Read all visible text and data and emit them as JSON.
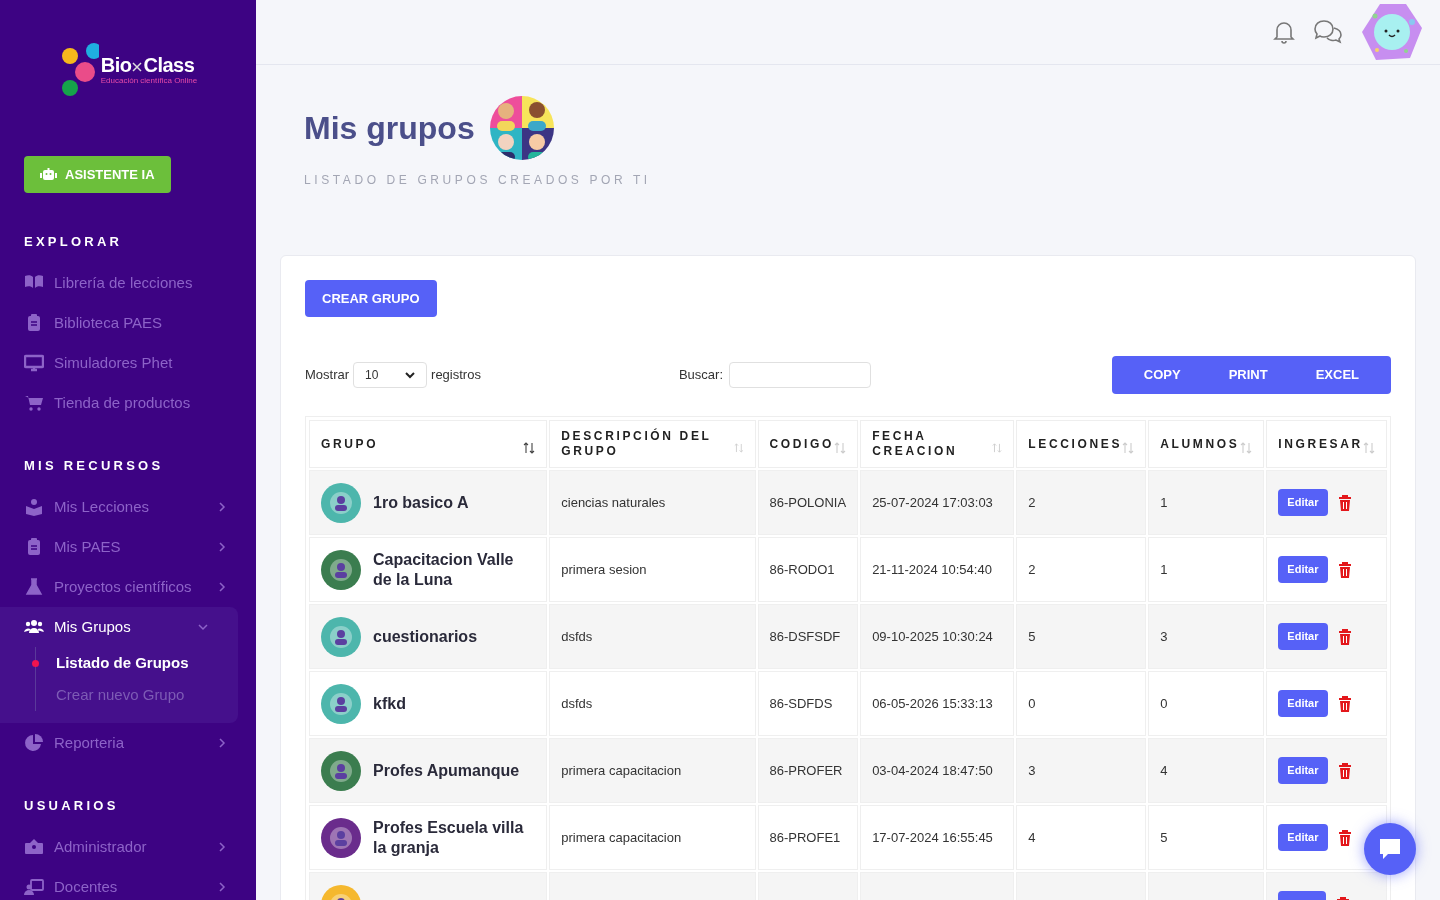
{
  "sidebar": {
    "logo": {
      "name": "Bio",
      "name2": "Class",
      "tagline": "Educación científica Online"
    },
    "assistant_button": "ASISTENTE IA",
    "sections": [
      {
        "title": "EXPLORAR",
        "items": [
          {
            "label": "Librería de lecciones",
            "kind": "book"
          },
          {
            "label": "Biblioteca PAES",
            "kind": "clipboard"
          },
          {
            "label": "Simuladores Phet",
            "kind": "monitor"
          },
          {
            "label": "Tienda de productos",
            "kind": "cart"
          }
        ]
      },
      {
        "title": "MIS RECURSOS",
        "items": [
          {
            "label": "Mis Lecciones",
            "kind": "reader",
            "expanded": false
          },
          {
            "label": "Mis PAES",
            "kind": "clipboard",
            "expanded": false
          },
          {
            "label": "Proyectos científicos",
            "kind": "flask",
            "expanded": false
          },
          {
            "label": "Mis Grupos",
            "kind": "users",
            "expanded": true,
            "children": [
              {
                "label": "Listado de Grupos",
                "selected": true
              },
              {
                "label": "Crear nuevo Grupo",
                "selected": false
              }
            ]
          },
          {
            "label": "Reporteria",
            "kind": "pie",
            "expanded": false
          }
        ]
      },
      {
        "title": "USUARIOS",
        "items": [
          {
            "label": "Administrador",
            "kind": "admin",
            "expanded": false
          },
          {
            "label": "Docentes",
            "kind": "teacher",
            "expanded": false
          }
        ]
      }
    ]
  },
  "header": {
    "title": "Mis grupos",
    "subtitle": "LISTADO DE GRUPOS CREADOS POR TI"
  },
  "create_button": "CREAR GRUPO",
  "length_control": {
    "before": "Mostrar",
    "value": "10",
    "after": "registros"
  },
  "search": {
    "label": "Buscar:"
  },
  "export_buttons": [
    "COPY",
    "PRINT",
    "EXCEL"
  ],
  "table": {
    "columns": [
      {
        "label": "GRUPO",
        "sorted": true
      },
      {
        "label": "DESCRIPCIÓN DEL GRUPO",
        "sorted": false
      },
      {
        "label": "CODIGO",
        "sorted": false
      },
      {
        "label": "FECHA CREACION",
        "sorted": false
      },
      {
        "label": "LECCIONES",
        "sorted": false
      },
      {
        "label": "ALUMNOS",
        "sorted": false
      },
      {
        "label": "INGRESAR",
        "sorted": false
      }
    ],
    "rows": [
      {
        "name": "1ro basico A",
        "color": "#4db6ac",
        "description": "ciencias naturales",
        "code": "86-POLONIA",
        "date": "25-07-2024 17:03:03",
        "lessons": "2",
        "students": "1",
        "action": "Editar"
      },
      {
        "name": "Capacitacion Valle de la Luna",
        "color": "#3b7d4f",
        "description": "primera sesion",
        "code": "86-RODO1",
        "date": "21-11-2024 10:54:40",
        "lessons": "2",
        "students": "1",
        "action": "Editar"
      },
      {
        "name": "cuestionarios",
        "color": "#4db6ac",
        "description": "dsfds",
        "code": "86-DSFSDF",
        "date": "09-10-2025 10:30:24",
        "lessons": "5",
        "students": "3",
        "action": "Editar"
      },
      {
        "name": "kfkd",
        "color": "#4db6ac",
        "description": "dsfds",
        "code": "86-SDFDS",
        "date": "06-05-2026 15:33:13",
        "lessons": "0",
        "students": "0",
        "action": "Editar"
      },
      {
        "name": "Profes Apumanque",
        "color": "#3b7d4f",
        "description": "primera capacitacion",
        "code": "86-PROFER",
        "date": "03-04-2024 18:47:50",
        "lessons": "3",
        "students": "4",
        "action": "Editar"
      },
      {
        "name": "Profes Escuela villa la granja",
        "color": "#6a2c8c",
        "description": "primera capacitacion",
        "code": "86-PROFE1",
        "date": "17-07-2024 16:55:45",
        "lessons": "4",
        "students": "5",
        "action": "Editar"
      },
      {
        "color": "#f5b82e"
      }
    ]
  }
}
